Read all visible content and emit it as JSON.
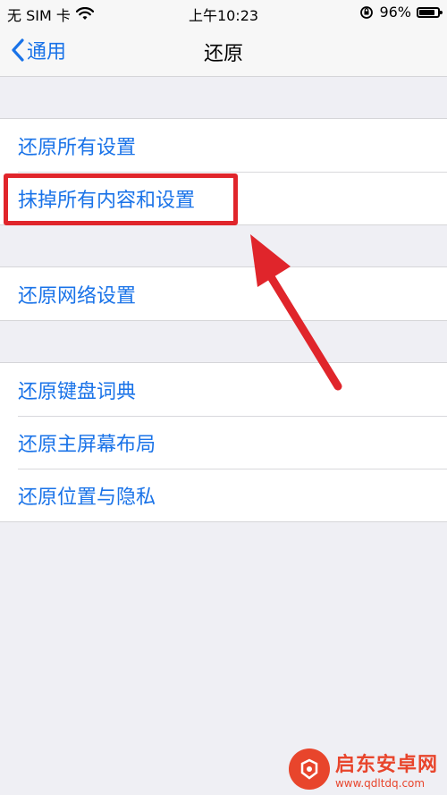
{
  "status_bar": {
    "carrier": "无 SIM 卡",
    "time": "上午10:23",
    "battery_percent": "96%",
    "battery_level": 0.96
  },
  "nav": {
    "back_label": "通用",
    "title": "还原"
  },
  "groups": [
    {
      "items": [
        "还原所有设置",
        "抹掉所有内容和设置"
      ]
    },
    {
      "items": [
        "还原网络设置"
      ]
    },
    {
      "items": [
        "还原键盘词典",
        "还原主屏幕布局",
        "还原位置与隐私"
      ]
    }
  ],
  "highlight": {
    "target": "抹掉所有内容和设置",
    "color": "#e0252b"
  },
  "accent_color": "#1a73e8",
  "watermark": {
    "name": "启东安卓网",
    "url": "www.qdltdq.com"
  }
}
